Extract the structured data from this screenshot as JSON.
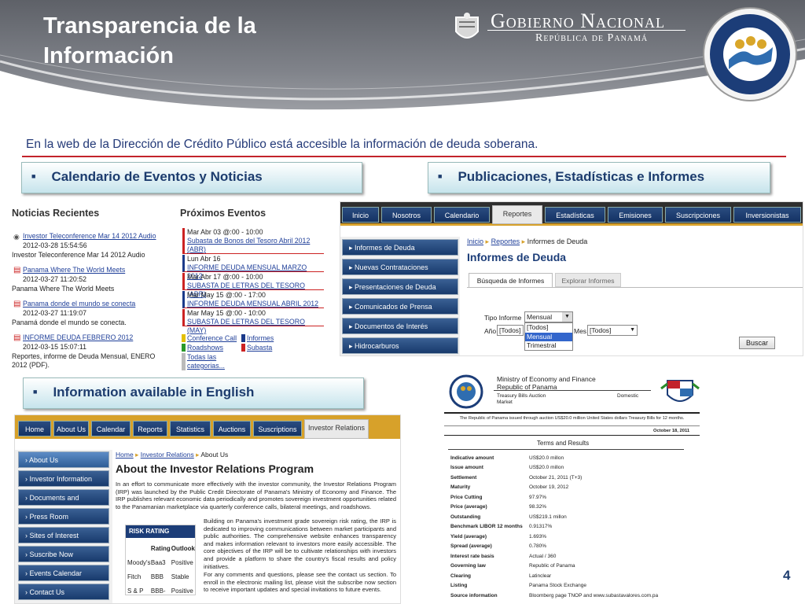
{
  "header": {
    "title": "Transparencia de la Información",
    "gov_line1": "Gobierno Nacional",
    "gov_line2": "República de Panamá",
    "page_number": "4"
  },
  "intro": "En la web de la Dirección de Crédito Público está accesible la información de deuda soberana.",
  "sections": {
    "calendar": "Calendario de Eventos y Noticias",
    "publications": "Publicaciones, Estadísticas e Informes",
    "english": "Information available in English"
  },
  "news": {
    "title": "Noticias Recientes",
    "items": [
      {
        "link": "Investor Teleconference Mar 14 2012 Audio",
        "date": "2012-03-28 15:54:56",
        "desc": "Investor Teleconference Mar 14 2012 Audio"
      },
      {
        "link": "Panama Where The World Meets",
        "date": "2012-03-27 11:20:52",
        "desc": "Panama Where The World Meets"
      },
      {
        "link": "Panama donde el mundo se conecta",
        "date": "2012-03-27 11:19:07",
        "desc": "Panamá donde el mundo se conecta."
      },
      {
        "link": "INFORME DEUDA FEBRERO 2012",
        "date": "2012-03-15 15:07:11",
        "desc": "Reportes, informe de Deuda Mensual, ENERO 2012 (PDF)."
      }
    ]
  },
  "events": {
    "title": "Próximos Eventos",
    "items": [
      {
        "when": "Mar Abr 03 @:00 - 10:00",
        "what": "Subasta de Bonos del Tesoro Abril 2012 (ABR)"
      },
      {
        "when": "Lun Abr 16",
        "what": "INFORME DEUDA MENSUAL MARZO 2012"
      },
      {
        "when": "Mar Abr 17 @:00 - 10:00",
        "what": "SUBASTA DE LETRAS DEL TESORO (ABR)"
      },
      {
        "when": "Mar May 15 @:00 - 17:00",
        "what": "INFORME DEUDA MENSUAL ABRIL 2012"
      },
      {
        "when": "Mar May 15 @:00 - 10:00",
        "what": "SUBASTA DE LETRAS DEL TESORO (MAY)"
      }
    ],
    "legend": [
      "Conference Call",
      "Informes",
      "Roadshows",
      "Subasta",
      "Todas las categorias..."
    ]
  },
  "site_es": {
    "tabs": [
      "Inicio",
      "Nosotros",
      "Calendario",
      "Reportes",
      "Estadísticas",
      "Emisiones",
      "Suscripciones",
      "Inversionistas"
    ],
    "side": [
      "Informes de Deuda",
      "Nuevas Contrataciones",
      "Presentaciones de Deuda",
      "Comunicados de Prensa",
      "Documentos de Interés",
      "Hidrocarburos"
    ],
    "breadcrumb": [
      "Inicio",
      "Reportes",
      "Informes de Deuda"
    ],
    "heading": "Informes de Deuda",
    "subtabs": [
      "Búsqueda de Informes",
      "Explorar Informes"
    ],
    "form": {
      "tipo_label": "Tipo Informe",
      "tipo_value": "Mensual",
      "options": [
        "[Todos]",
        "Mensual",
        "Trimestral"
      ],
      "ano_label": "Año",
      "ano_value": "[Todos]",
      "mes_label": "Mes",
      "mes_value": "[Todos]",
      "button": "Buscar"
    }
  },
  "site_en": {
    "tabs": [
      "Home",
      "About Us",
      "Calendar",
      "Reports",
      "Statistics",
      "Auctions",
      "Suscriptions",
      "Investor Relations"
    ],
    "side": [
      "About Us",
      "Investor Information",
      "Documents and Statistics",
      "Press Room",
      "Sites of Interest",
      "Suscribe Now",
      "Events Calendar",
      "Contact Us"
    ],
    "breadcrumb": [
      "Home",
      "Investor Relations",
      "About Us"
    ],
    "heading": "About the Investor Relations Program",
    "para1": "In an effort to communicate more effectively with the investor community, the Investor Relations Program (IRP) was launched by the Public Credit Directorate of Panama's Ministry of Economy and Finance. The IRP publishes relevant economic data periodically and promotes sovereign investment opportunities related to the Panamanian marketplace via quarterly conference calls, bilateral meetings, and roadshows.",
    "para2": "Building on Panama's investment grade sovereign risk rating, the IRP is dedicated to improving communications between market participants and public authorities. The comprehensive website enhances transparency and makes information relevant to investors more easily accessible. The core objectives of the IRP will be to cultivate relationships with investors and provide a platform to share the country's fiscal results and policy initiatives.",
    "para3": "For any comments and questions, please see the contact us section. To enroll in the electronic mailing list, please visit the subscribe now section to receive important updates and special invitations to future events.",
    "risk": {
      "title": "RISK RATING",
      "headers": [
        "",
        "Rating",
        "Outlook"
      ],
      "rows": [
        [
          "Moody's",
          "Baa3",
          "Positive"
        ],
        [
          "Fitch",
          "BBB",
          "Stable"
        ],
        [
          "S & P",
          "BBB-",
          "Positive"
        ]
      ]
    }
  },
  "auction": {
    "ministry1": "Ministry of Economy and Finance",
    "ministry2": "Republic of Panama",
    "type1": "Treasury Bills Auction",
    "type2": "Market",
    "type3": "Domestic",
    "summary": "The Republic of Panama issued through auction US$20.0 million United States dollars Treasury Bills for 12 months.",
    "date": "October 18, 2011",
    "table_title": "Terms and Results",
    "rows": [
      [
        "Indicative amount",
        "US$20.0 millon"
      ],
      [
        "Issue amount",
        "US$20.0 millon"
      ],
      [
        "Settlement",
        "October 21, 2011 (T+3)"
      ],
      [
        "Maturity",
        "October 19, 2012"
      ],
      [
        "Price Cutting",
        "97.97%"
      ],
      [
        "Price (average)",
        "98.32%"
      ],
      [
        "Outstanding",
        "US$219.1 millon"
      ],
      [
        "Benchmark LIBOR 12 months",
        "0.91317%"
      ],
      [
        "Yield (average)",
        "1.693%"
      ],
      [
        "Spread (average)",
        "0.780%"
      ],
      [
        "Interest rate basis",
        "Actual / 360"
      ],
      [
        "Governing law",
        "Republic of Panama"
      ],
      [
        "Clearing",
        "Latinclear"
      ],
      [
        "Listing",
        "Panama Stock Exchange"
      ],
      [
        "Source information",
        "Bloomberg page TNOP and www.subastavalores.com.pa"
      ]
    ]
  },
  "colors": {
    "accent_red": "#c3232b",
    "nav_blue": "#1b3a6b",
    "bar_text": "#1d3c6e"
  }
}
